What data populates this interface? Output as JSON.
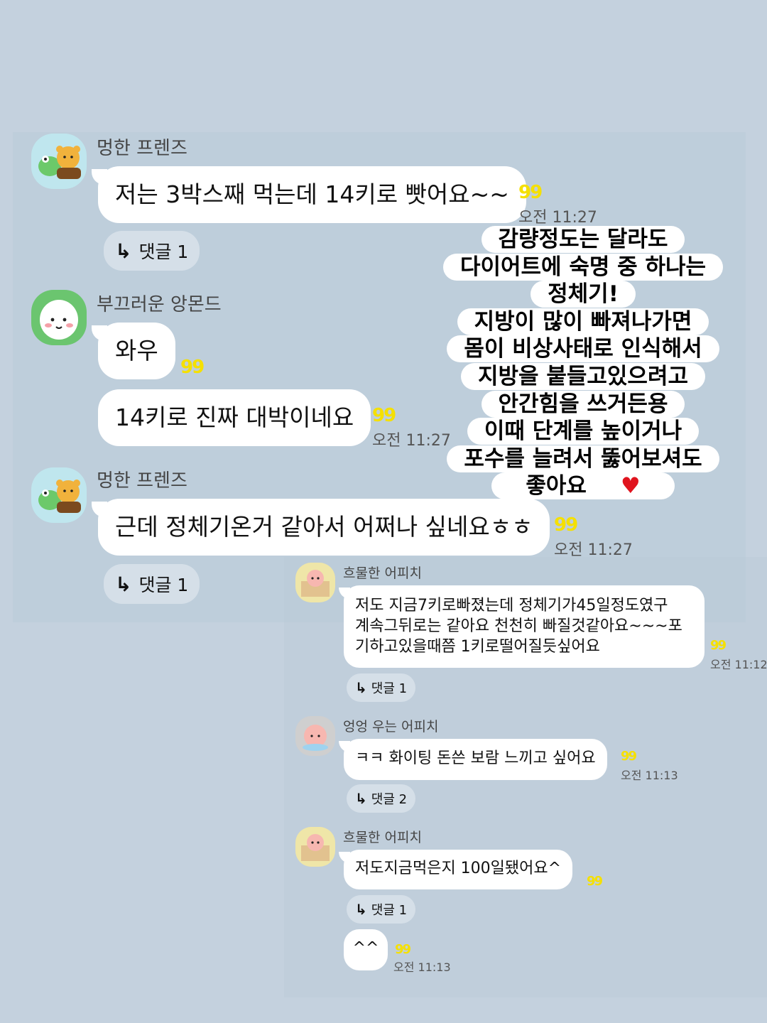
{
  "messages_top": [
    {
      "sender": "멍한 프렌즈",
      "text": "저는 3박스째 먹는데 14키로 빳어요~~",
      "time": "오전 11:27",
      "reply": "댓글 1"
    },
    {
      "sender": "부끄러운 앙몬드",
      "text1": "와우",
      "text2": "14키로 진짜 대박이네요",
      "time": "오전 11:27"
    },
    {
      "sender": "멍한 프렌즈",
      "text": "근데 정체기온거 같아서 어쩌나 싶네요ㅎㅎ",
      "time": "오전 11:27",
      "reply": "댓글 1"
    }
  ],
  "messages_bottom": [
    {
      "sender": "흐물한 어피치",
      "lines": [
        "저도 지금7키로빠졌는데 정체기가45일정도였구",
        "계속그뒤로는 같아요 천천히 빠질것같아요~~~포",
        "기하고있을때쯤 1키로떨어질듯싶어요"
      ],
      "time": "오전 11:12",
      "reply": "댓글 1"
    },
    {
      "sender": "엉엉 우는 어피치",
      "text": "ㅋㅋ 화이팅 돈쓴 보람 느끼고 싶어요",
      "time": "오전 11:13",
      "reply": "댓글 2"
    },
    {
      "sender": "흐물한 어피치",
      "text": "저도지금먹은지 100일됐어요^",
      "reply": "댓글 1"
    },
    {
      "text": "^^",
      "time": "오전 11:13"
    }
  ],
  "read_mark": "99",
  "reply_arrow": "↳",
  "overlay_lines": [
    "감량정도는 달라도",
    "다이어트에 숙명 중 하나는",
    "정체기!",
    "지방이 많이 빠져나가면",
    "몸이 비상사태로 인식해서",
    "지방을 붙들고있으려고",
    "안간힘을 쓰거든용",
    "이때 단계를 높이거나",
    "포수를 늘려서 뚫어보셔도"
  ],
  "overlay_last_line": "좋아요",
  "heart": "♥",
  "colors": {
    "background": "#c4d1de",
    "bubble": "#ffffff",
    "read_mark": "#f5e000",
    "heart": "#e0141e"
  }
}
